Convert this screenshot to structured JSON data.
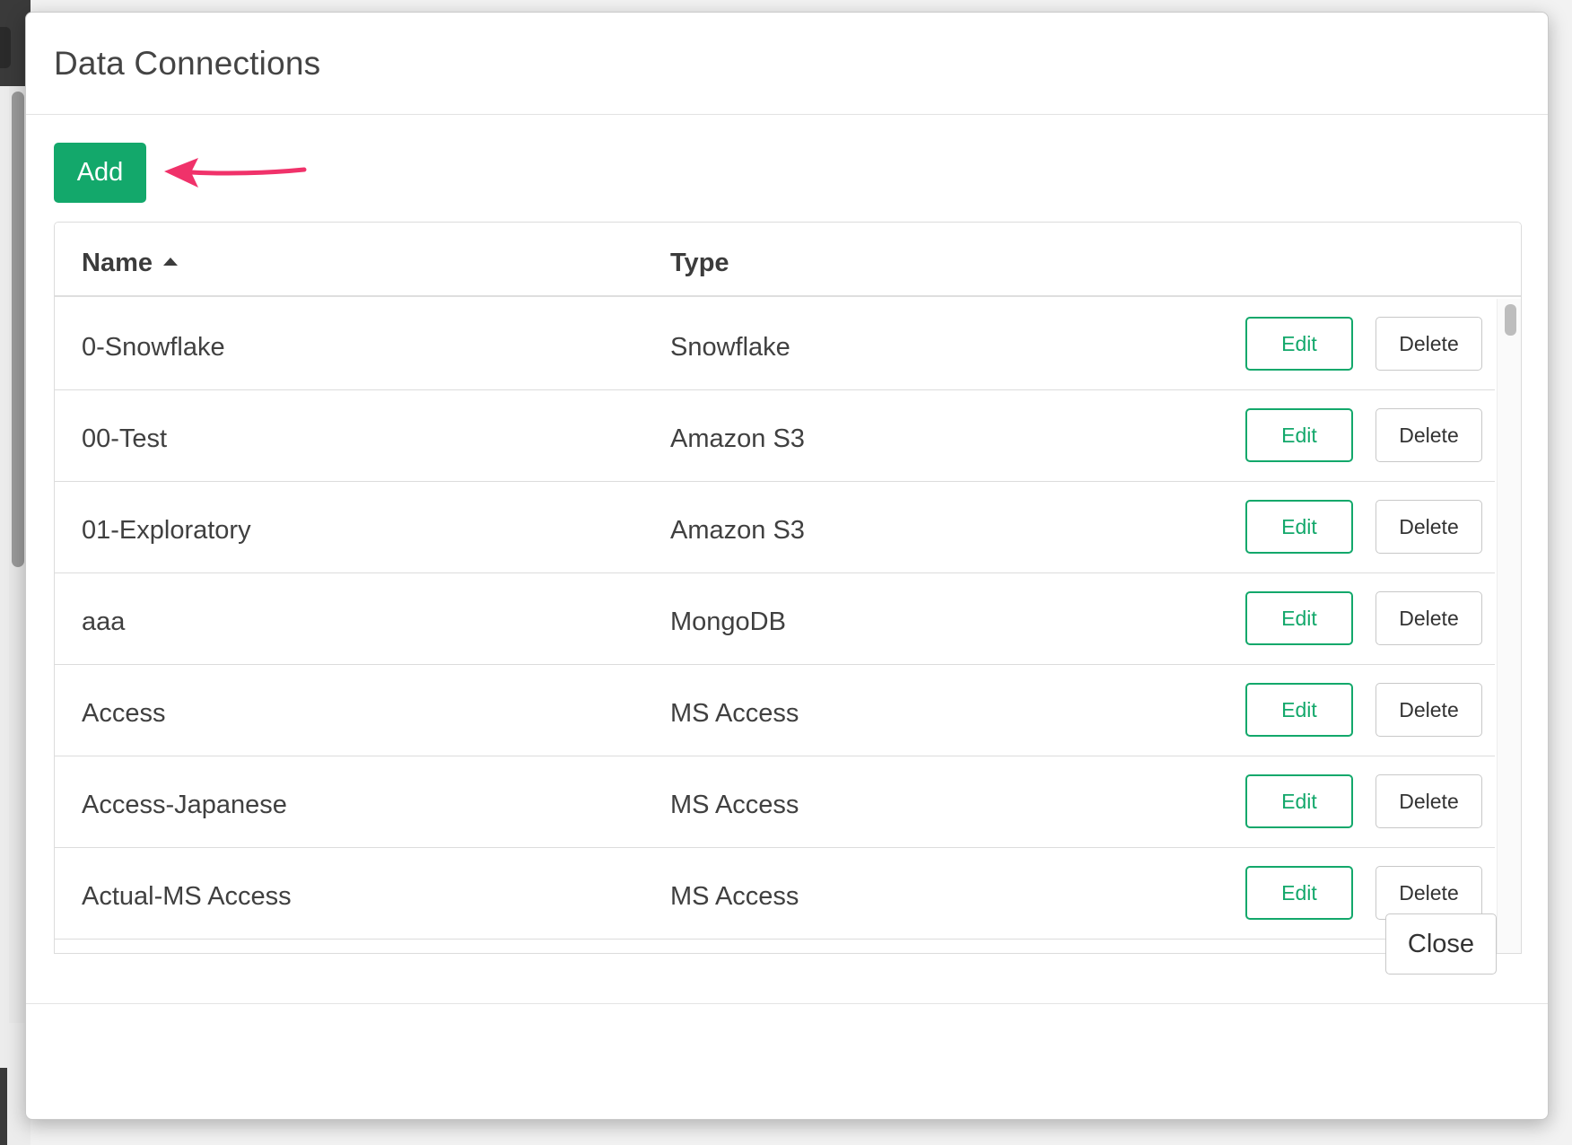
{
  "dialog": {
    "title": "Data Connections",
    "add_label": "Add",
    "close_label": "Close"
  },
  "table": {
    "columns": [
      {
        "label": "Name",
        "sorted": "ascending"
      },
      {
        "label": "Type"
      }
    ],
    "rows": [
      {
        "name": "0-Snowflake",
        "type": "Snowflake"
      },
      {
        "name": "00-Test",
        "type": "Amazon S3"
      },
      {
        "name": "01-Exploratory",
        "type": "Amazon S3"
      },
      {
        "name": "aaa",
        "type": "MongoDB"
      },
      {
        "name": "Access",
        "type": "MS Access"
      },
      {
        "name": "Access-Japanese",
        "type": "MS Access"
      },
      {
        "name": "Actual-MS Access",
        "type": "MS Access"
      }
    ],
    "edit_label": "Edit",
    "delete_label": "Delete"
  },
  "colors": {
    "accent": "#13a86b",
    "annotation_arrow": "#f0326a"
  },
  "icons": {
    "sort": "caret-up-icon",
    "annotation": "arrow-left-icon"
  }
}
